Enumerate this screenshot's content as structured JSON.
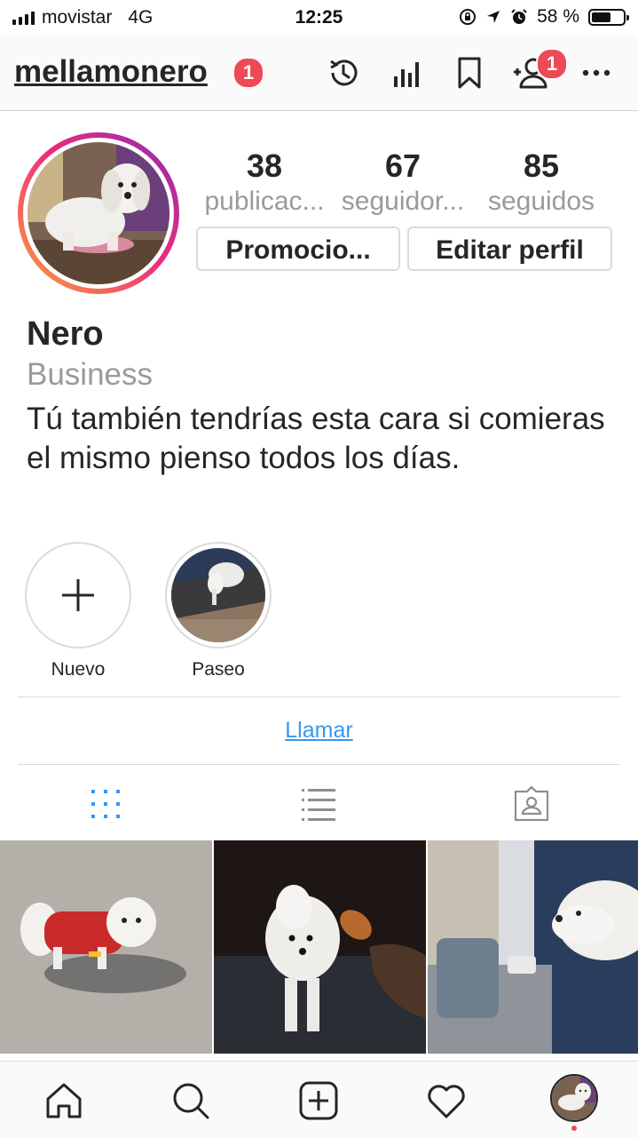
{
  "status_bar": {
    "carrier": "movistar",
    "network": "4G",
    "time": "12:25",
    "battery_percent": "58 %",
    "battery_level": 0.58
  },
  "header": {
    "username": "mellamonero",
    "username_badge": "1",
    "people_badge": "1",
    "icons": [
      "history-icon",
      "insights-icon",
      "bookmark-icon",
      "add-person-icon",
      "more-icon"
    ]
  },
  "profile": {
    "stats": [
      {
        "value": "38",
        "label": "publicac..."
      },
      {
        "value": "67",
        "label": "seguidor..."
      },
      {
        "value": "85",
        "label": "seguidos"
      }
    ],
    "promote_button": "Promocio...",
    "edit_button": "Editar perfil",
    "name": "Nero",
    "category": "Business",
    "bio": "Tú también tendrías esta cara si comieras el mismo pienso todos los días."
  },
  "highlights": [
    {
      "label": "Nuevo"
    },
    {
      "label": "Paseo"
    }
  ],
  "contact": {
    "call_label": "Llamar"
  },
  "tabs": [
    "grid-icon",
    "list-icon",
    "tagged-icon"
  ],
  "colors": {
    "accent_blue": "#3897f0",
    "badge_red": "#ed4956"
  },
  "bottom_nav": [
    "home-icon",
    "search-icon",
    "new-post-icon",
    "activity-icon",
    "profile-avatar"
  ]
}
